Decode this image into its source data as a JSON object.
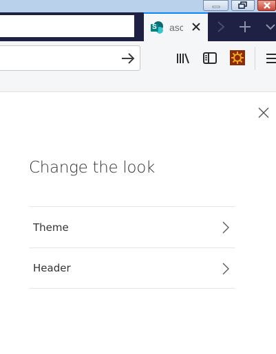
{
  "browser": {
    "tab": {
      "title": "asc",
      "favicon": "sharepoint-icon",
      "favicon_letter": "S",
      "favicon_color": "#038387"
    },
    "accent_color": "#0a84ff",
    "icons": {
      "window_minimize": "minimize-icon",
      "window_restore": "restore-icon",
      "window_close": "close-icon",
      "tab_close": "close-icon",
      "tab_scroll": "chevron-right-icon",
      "new_tab": "plus-icon",
      "tab_list": "chevron-down-icon",
      "go": "arrow-right-icon",
      "library": "library-icon",
      "sidebar": "sidebar-icon",
      "extension": "extension-icon",
      "menu": "hamburger-menu-icon"
    }
  },
  "panel": {
    "title": "Change the look",
    "close_icon": "close-icon",
    "options": [
      {
        "label": "Theme",
        "icon": "chevron-right-icon"
      },
      {
        "label": "Header",
        "icon": "chevron-right-icon"
      }
    ]
  }
}
